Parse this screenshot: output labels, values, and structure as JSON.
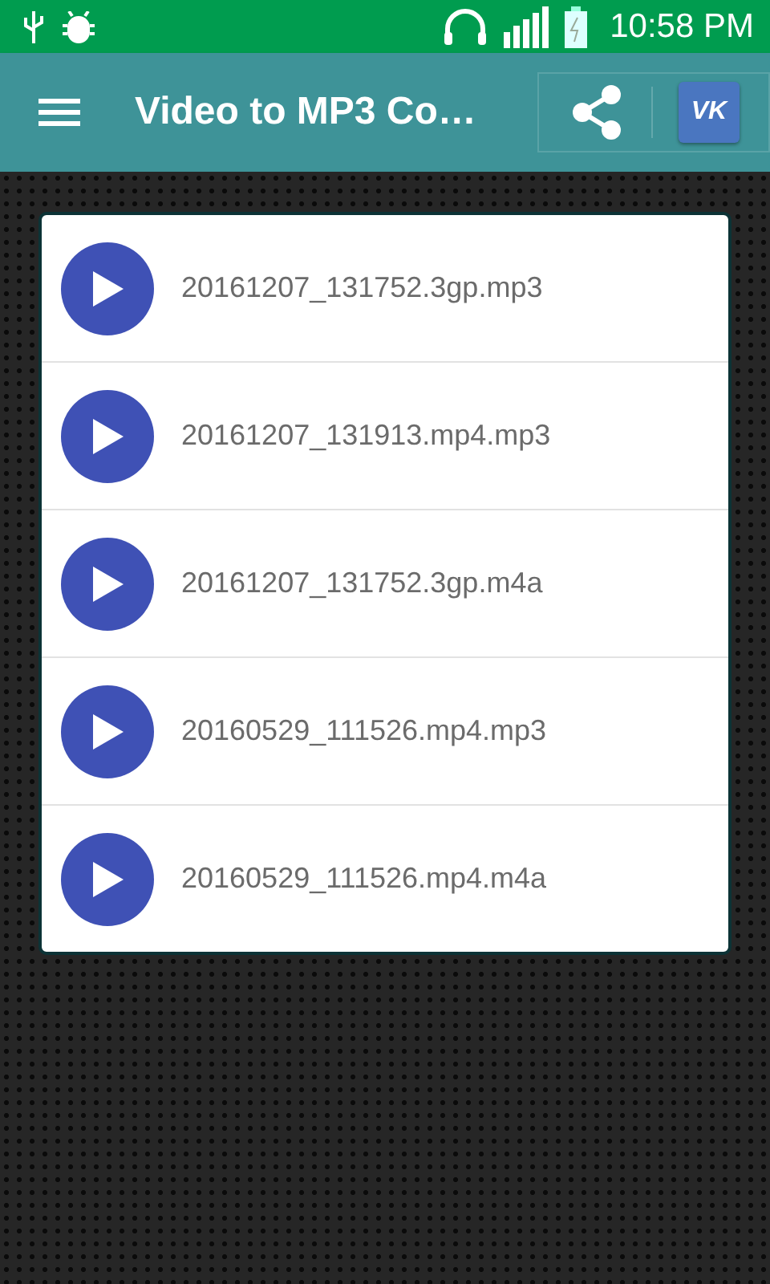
{
  "status_bar": {
    "time": "10:58 PM"
  },
  "toolbar": {
    "title": "Video to MP3 Co…",
    "vk_label": "VK"
  },
  "files": [
    {
      "name": "20161207_131752.3gp.mp3"
    },
    {
      "name": "20161207_131913.mp4.mp3"
    },
    {
      "name": "20161207_131752.3gp.m4a"
    },
    {
      "name": "20160529_111526.mp4.mp3"
    },
    {
      "name": "20160529_111526.mp4.m4a"
    }
  ]
}
